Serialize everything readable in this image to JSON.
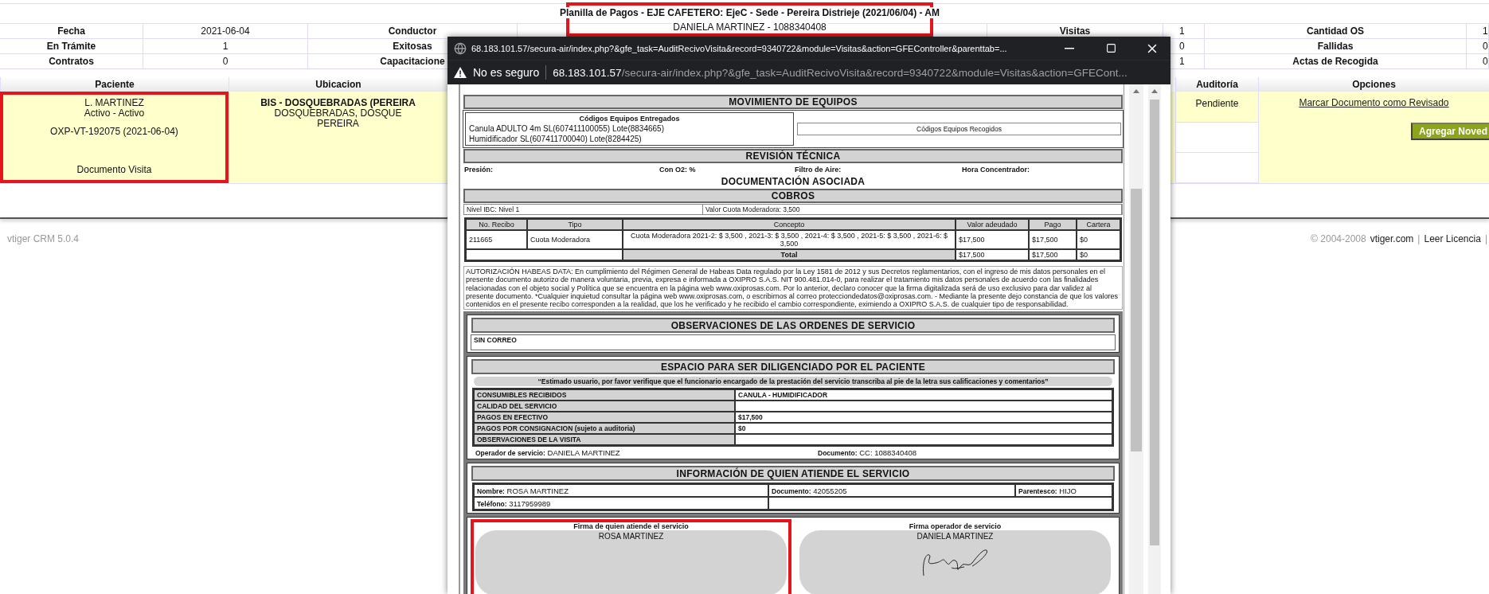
{
  "header": {
    "title": "Planilla de Pagos - EJE CAFETERO: EjeC - Sede - Pereira Distrieje (2021/06/04) - AM",
    "subtitle": "DANIELA MARTINEZ - 1088340408",
    "highlighted": true
  },
  "summary": [
    {
      "label1": "Fecha",
      "value1": "2021-06-04",
      "label2": "Conductor",
      "label3": "Visitas",
      "value3": "1",
      "label4": "Cantidad OS",
      "value4": "1"
    },
    {
      "label1": "En Trámite",
      "value1": "1",
      "label2": "Exitosas",
      "value3": "0",
      "label4": "Fallidas",
      "value4": "0"
    },
    {
      "label1": "Contratos",
      "value1": "0",
      "label2": "Capacitacione",
      "value3": "1",
      "label4": "Actas de Recogida",
      "value4": "0"
    }
  ],
  "patients": {
    "columns": [
      "Paciente",
      "Ubicacion",
      "Auditoría",
      "Opciones"
    ],
    "row": {
      "patient": {
        "name": "L. MARTINEZ",
        "status": "Activo - Activo",
        "visit": "OXP-VT-192075 (2021-06-04)",
        "document": "Documento Visita",
        "highlighted": true
      },
      "location": [
        "BIS - DOSQUEBRADAS (PEREIRA",
        "DOSQUEBRADAS, DOSQUE",
        "PEREIRA"
      ],
      "audit": "Pendiente",
      "link": "Marcar Documento como Revisado",
      "button": "Agregar Noved"
    }
  },
  "footer": {
    "version": "vtiger CRM 5.0.4",
    "right": [
      {
        "kind": "text",
        "text": "© 2004-2008"
      },
      {
        "kind": "link",
        "text": "vtiger.com"
      },
      {
        "kind": "sep",
        "text": "|"
      },
      {
        "kind": "link",
        "text": "Leer Licencia"
      },
      {
        "kind": "sep",
        "text": "|"
      }
    ]
  },
  "popup": {
    "title": "68.183.101.57/secura-air/index.php?&gfe_task=AuditRecivoVisita&record=9340722&module=Visitas&action=GFEController&parenttab=...",
    "security": "No es seguro",
    "host": "68.183.101.57",
    "path": "/secura-air/index.php?&gfe_task=AuditRecivoVisita&record=9340722&module=Visitas&action=GFECont...",
    "equipment": {
      "title": "MOVIMIENTO DE EQUIPOS",
      "delivered_heading": "Códigos Equipos Entregados",
      "delivered": [
        "Canula ADULTO 4m SL(607411100055) Lote(8834665)",
        "Humidificador SL(607411700040) Lote(8284425)"
      ],
      "collected_heading": "Códigos Equipos Recogidos"
    },
    "technical": {
      "title": "REVISIÓN TÉCNICA",
      "fields": [
        "Presión:",
        "Con O2: %",
        "Filtro de Aire:",
        "Hora Concentrador:"
      ]
    },
    "docs_title": "DOCUMENTACIÓN ASOCIADA",
    "charges": {
      "title": "COBROS",
      "info": [
        "Nivel IBC: Nivel 1",
        "Valor Cuota Moderadora: 3,500"
      ],
      "columns": [
        "No. Recibo",
        "Tipo",
        "Concepto",
        "Valor adeudado",
        "Pago",
        "Cartera"
      ],
      "rows": [
        [
          "211665",
          "Cuota Moderadora",
          "Cuota Moderadora 2021-2: $ 3,500 , 2021-3: $ 3,500 , 2021-4: $ 3,500 , 2021-5: $ 3,500 , 2021-6: $ 3,500",
          "$17,500",
          "$17,500",
          "$0"
        ]
      ],
      "total": {
        "label": "Total",
        "values": [
          "$17,500",
          "$17,500",
          "$0"
        ]
      }
    },
    "habeas": "AUTORIZACIÓN HABEAS DATA: En cumplimiento del Régimen General de Habeas Data regulado por la Ley 1581 de 2012 y sus Decretos reglamentarios, con el ingreso de mis datos personales en el presente documento autorizo de manera voluntaria, previa, expresa e informada a OXIPRO S.A.S. NIT 900.481.014-0, para realizar el tratamiento mis datos personales de acuerdo con las finalidades relacionadas con el objeto social y Política que se encuentra en la página web www.oxiprosas.com. Por lo anterior, declaro conocer que la firma digitalizada será de uso exclusivo para dar validez al presente documento. *Cualquier inquietud consultar la página web www.oxiprosas.com, o escribirnos al correo protecciondedatos@oxiprosas.com. - Mediante la presente dejo constancia de que los valores contenidos en el presente recibo corresponden a la realidad, que los he verificado y he recibido el cambio correspondiente, eximiendo a OXIPRO S.A.S. de cualquier tipo de responsabilidad.",
    "observations": {
      "title": "OBSERVACIONES DE LAS ORDENES DE SERVICIO",
      "value": "SIN CORREO"
    },
    "patient_space": {
      "title": "ESPACIO PARA SER DILIGENCIADO POR EL PACIENTE",
      "note": "“Estimado usuario, por favor verifique que el funcionario encargado de la prestación del servicio transcriba al pie de la letra sus calificaciones y comentarios”",
      "rows": [
        {
          "label": "CONSUMIBLES RECIBIDOS",
          "value": "CANULA - HUMIDIFICADOR"
        },
        {
          "label": "CALIDAD DEL SERVICIO"
        },
        {
          "label": "PAGOS EN EFECTIVO",
          "value": "$17,500"
        },
        {
          "label": "PAGOS POR CONSIGNACION (sujeto a auditoria)",
          "value": "$0"
        },
        {
          "label": "OBSERVACIONES DE LA VISITA"
        }
      ],
      "operator": [
        {
          "label": "Operador de servicio:",
          "value": "DANIELA MARTINEZ"
        },
        {
          "label": "Documento:",
          "value": "CC: 1088340408"
        }
      ]
    },
    "attendant": {
      "title": "INFORMACIÓN DE QUIEN ATIENDE EL SERVICIO",
      "fields": [
        {
          "label": "Nombre:",
          "value": "ROSA MARTINEZ"
        },
        {
          "label": "Documento:",
          "value": "42055205"
        },
        {
          "label": "Parentesco:",
          "value": "HIJO"
        },
        {
          "label": "Teléfono:",
          "value": "3117959989"
        }
      ]
    },
    "signatures": [
      {
        "label": "Firma de quien atiende el servicio",
        "name": "ROSA MARTINEZ",
        "signed": false,
        "highlighted": true
      },
      {
        "label": "Firma operador de servicio",
        "name": "DANIELA MARTINEZ",
        "signed": true,
        "highlighted": false
      }
    ]
  }
}
